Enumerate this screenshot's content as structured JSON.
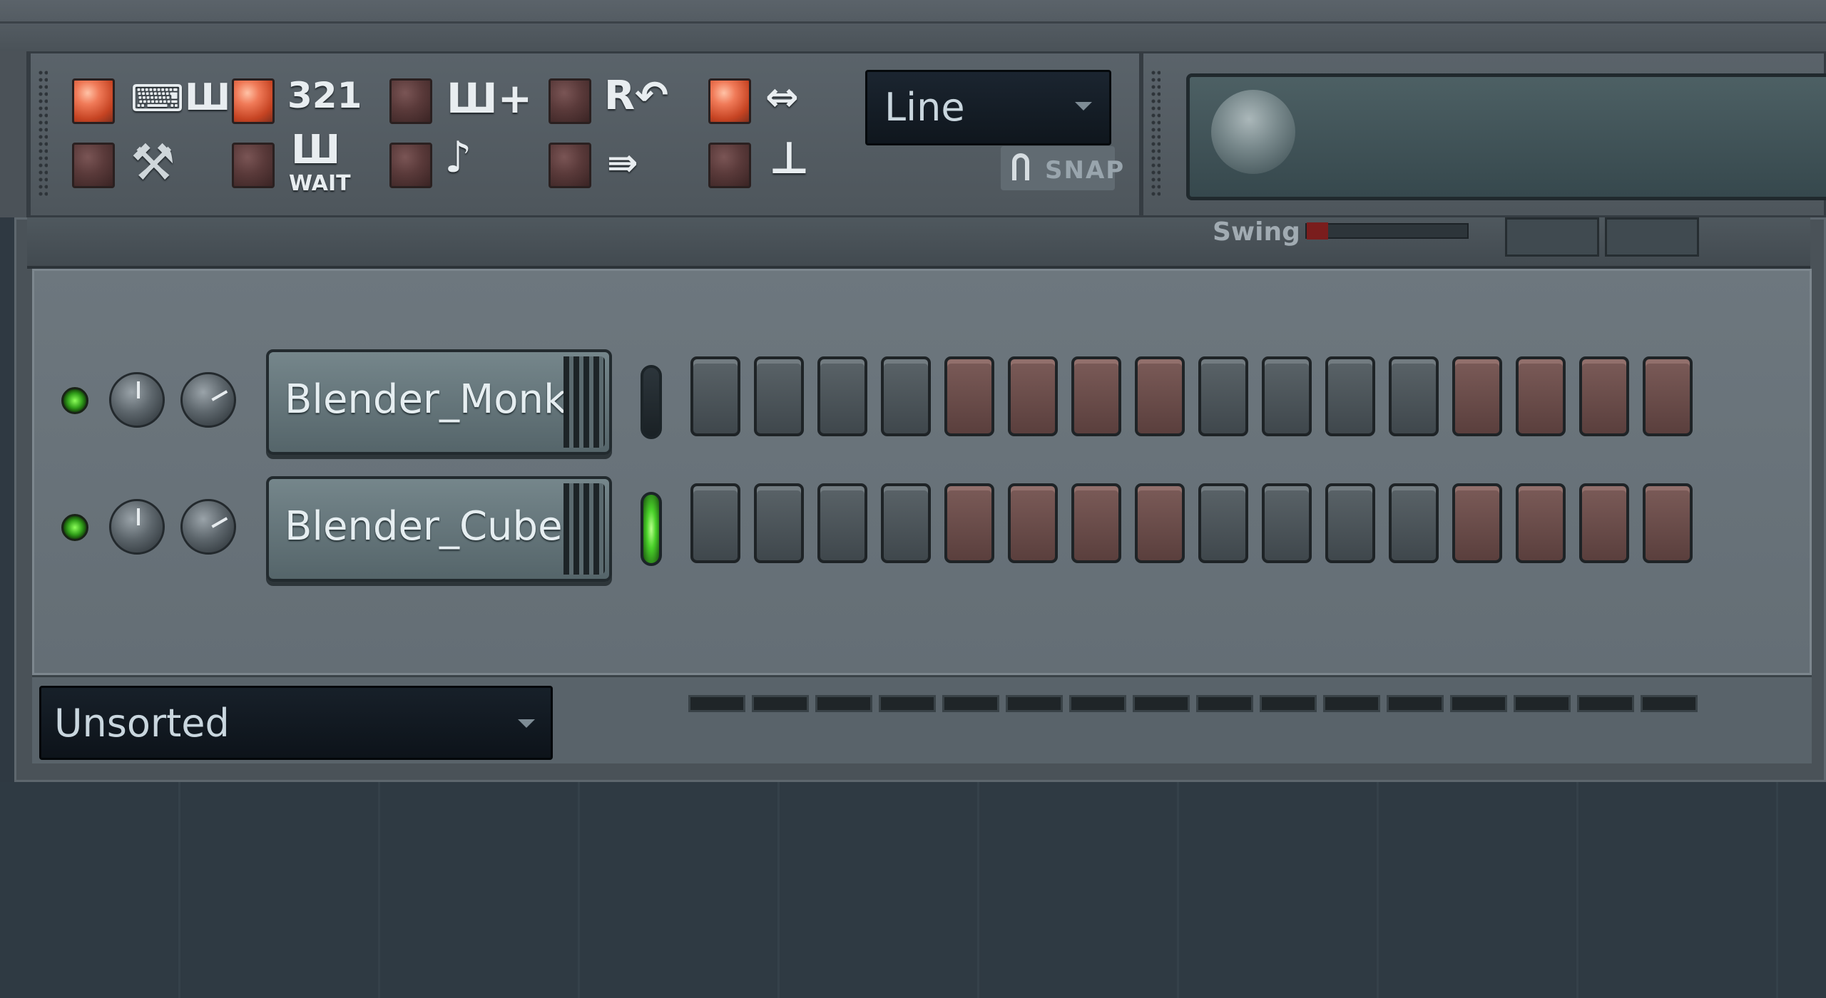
{
  "toolbar": {
    "mode_select": {
      "value": "Line"
    },
    "snap_label": "SNAP",
    "countdown_icon": "321",
    "wait_label": "WAIT",
    "recording_icon": "R↶",
    "buttons": [
      {
        "id": "typing-keyboard",
        "state": "on"
      },
      {
        "id": "metronome-countdown",
        "state": "on"
      },
      {
        "id": "step-edit",
        "state": "off"
      },
      {
        "id": "recording-filter",
        "state": "off"
      },
      {
        "id": "loop-recording",
        "state": "on"
      },
      {
        "id": "scale-levels",
        "state": "off"
      },
      {
        "id": "wait-for-input",
        "state": "off"
      },
      {
        "id": "blend-notes",
        "state": "off"
      },
      {
        "id": "multilink",
        "state": "off"
      },
      {
        "id": "joystick",
        "state": "off"
      }
    ],
    "colors": {
      "led_on": "#f07a58",
      "led_off": "#5a3a3a"
    }
  },
  "rack": {
    "swing_label": "Swing",
    "channels": [
      {
        "name": "Blender_Monk...",
        "selected": false,
        "steps": [
          "gray",
          "gray",
          "gray",
          "gray",
          "red",
          "red",
          "red",
          "red",
          "gray",
          "gray",
          "gray",
          "gray",
          "red",
          "red",
          "red",
          "red"
        ]
      },
      {
        "name": "Blender_Cube...",
        "selected": true,
        "steps": [
          "gray",
          "gray",
          "gray",
          "gray",
          "red",
          "red",
          "red",
          "red",
          "gray",
          "gray",
          "gray",
          "gray",
          "red",
          "red",
          "red",
          "red"
        ]
      }
    ],
    "filter_select": {
      "value": "Unsorted"
    },
    "colors": {
      "step_gray": "#4a5358",
      "step_red": "#6a4a47",
      "channel_led": "#31a01a",
      "selected_indicator": "#4ad12a"
    }
  }
}
